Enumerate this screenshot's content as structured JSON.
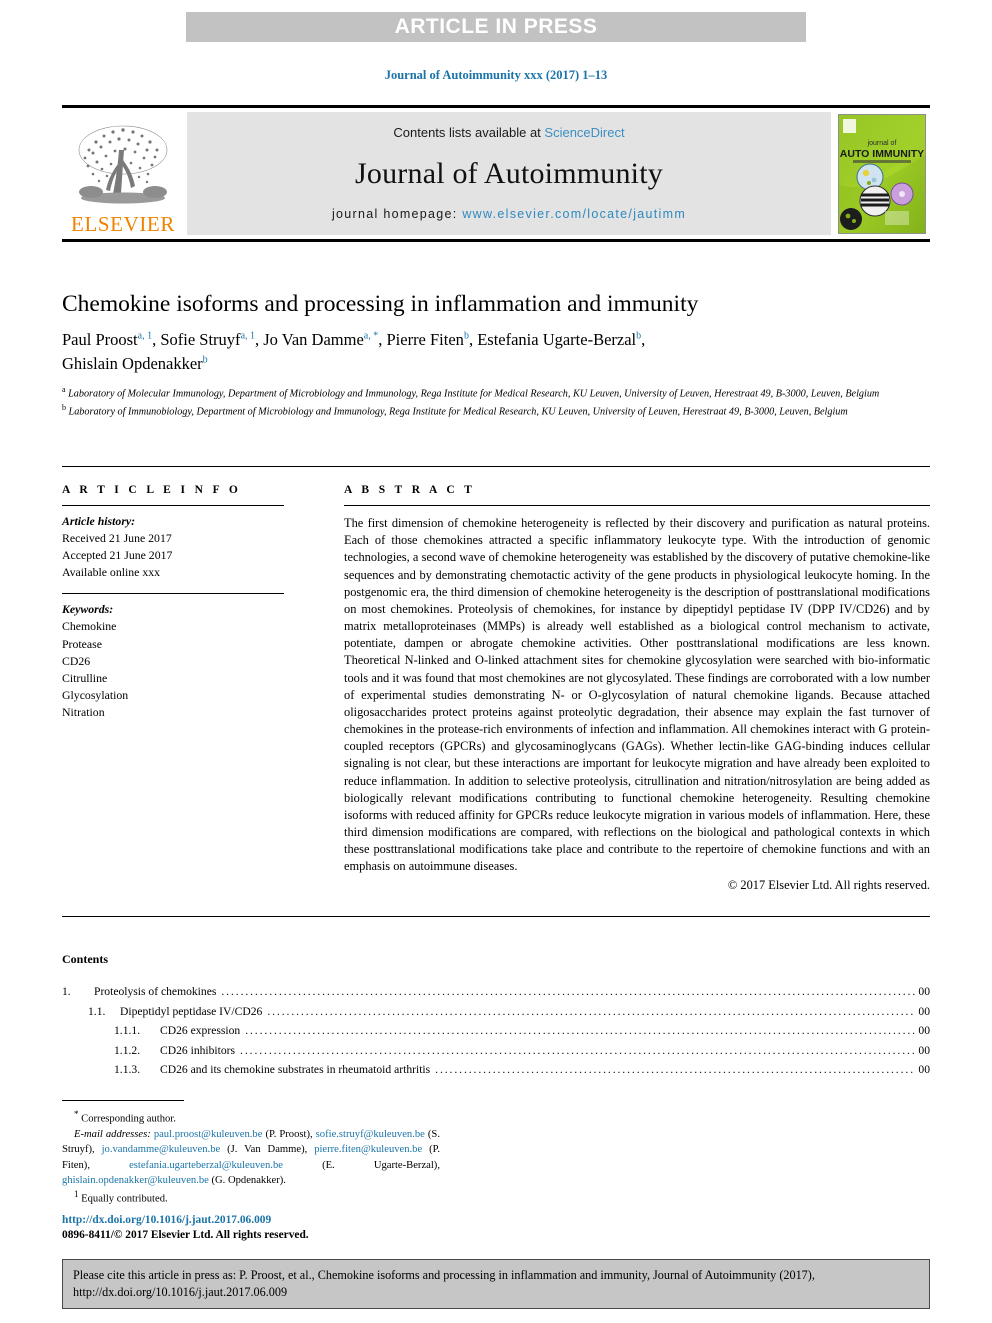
{
  "banner": {
    "text": "ARTICLE IN PRESS"
  },
  "journal_ref": "Journal of Autoimmunity xxx (2017) 1–13",
  "masthead": {
    "contents_prefix": "Contents lists available at ",
    "sciencedirect": "ScienceDirect",
    "journal_name": "Journal of Autoimmunity",
    "homepage_prefix": "journal homepage: ",
    "homepage_url": "www.elsevier.com/locate/jautimm",
    "publisher": "ELSEVIER",
    "cover_title_small": "journal of",
    "cover_title_large": "AUTO IMMUNITY"
  },
  "article": {
    "title": "Chemokine isoforms and processing in inflammation and immunity",
    "authors_line_1": "Paul Proost",
    "authors": [
      {
        "name": "Paul Proost",
        "marks": "a, 1"
      },
      {
        "name": "Sofie Struyf",
        "marks": "a, 1"
      },
      {
        "name": "Jo Van Damme",
        "marks": "a, *"
      },
      {
        "name": "Pierre Fiten",
        "marks": "b"
      },
      {
        "name": "Estefania Ugarte-Berzal",
        "marks": "b"
      },
      {
        "name": "Ghislain Opdenakker",
        "marks": "b"
      }
    ],
    "affiliations": [
      {
        "mark": "a",
        "text": "Laboratory of Molecular Immunology, Department of Microbiology and Immunology, Rega Institute for Medical Research, KU Leuven, University of Leuven, Herestraat 49, B-3000, Leuven, Belgium"
      },
      {
        "mark": "b",
        "text": "Laboratory of Immunobiology, Department of Microbiology and Immunology, Rega Institute for Medical Research, KU Leuven, University of Leuven, Herestraat 49, B-3000, Leuven, Belgium"
      }
    ]
  },
  "article_info": {
    "heading": "A R T I C L E   I N F O",
    "history_label": "Article history:",
    "history": [
      "Received 21 June 2017",
      "Accepted 21 June 2017",
      "Available online xxx"
    ],
    "keywords_label": "Keywords:",
    "keywords": [
      "Chemokine",
      "Protease",
      "CD26",
      "Citrulline",
      "Glycosylation",
      "Nitration"
    ]
  },
  "abstract": {
    "heading": "A B S T R A C T",
    "body": "The first dimension of chemokine heterogeneity is reflected by their discovery and purification as natural proteins. Each of those chemokines attracted a specific inflammatory leukocyte type. With the introduction of genomic technologies, a second wave of chemokine heterogeneity was established by the discovery of putative chemokine-like sequences and by demonstrating chemotactic activity of the gene products in physiological leukocyte homing. In the postgenomic era, the third dimension of chemokine heterogeneity is the description of posttranslational modifications on most chemokines. Proteolysis of chemokines, for instance by dipeptidyl peptidase IV (DPP IV/CD26) and by matrix metalloproteinases (MMPs) is already well established as a biological control mechanism to activate, potentiate, dampen or abrogate chemokine activities. Other posttranslational modifications are less known. Theoretical N-linked and O-linked attachment sites for chemokine glycosylation were searched with bio-informatic tools and it was found that most chemokines are not glycosylated. These findings are corroborated with a low number of experimental studies demonstrating N- or O-glycosylation of natural chemokine ligands. Because attached oligosaccharides protect proteins against proteolytic degradation, their absence may explain the fast turnover of chemokines in the protease-rich environments of infection and inflammation. All chemokines interact with G protein-coupled receptors (GPCRs) and glycosaminoglycans (GAGs). Whether lectin-like GAG-binding induces cellular signaling is not clear, but these interactions are important for leukocyte migration and have already been exploited to reduce inflammation. In addition to selective proteolysis, citrullination and nitration/nitrosylation are being added as biologically relevant modifications contributing to functional chemokine heterogeneity. Resulting chemokine isoforms with reduced affinity for GPCRs reduce leukocyte migration in various models of inflammation. Here, these third dimension modifications are compared, with reflections on the biological and pathological contexts in which these posttranslational modifications take place and contribute to the repertoire of chemokine functions and with an emphasis on autoimmune diseases.",
    "copyright": "© 2017 Elsevier Ltd. All rights reserved."
  },
  "contents": {
    "heading": "Contents",
    "items": [
      {
        "level": 1,
        "number": "1.",
        "label": "Proteolysis of chemokines",
        "page": "00"
      },
      {
        "level": 2,
        "number": "1.1.",
        "label": "Dipeptidyl peptidase IV/CD26",
        "page": "00"
      },
      {
        "level": 3,
        "number": "1.1.1.",
        "label": "CD26 expression",
        "page": "00"
      },
      {
        "level": 3,
        "number": "1.1.2.",
        "label": "CD26 inhibitors",
        "page": "00"
      },
      {
        "level": 3,
        "number": "1.1.3.",
        "label": "CD26 and its chemokine substrates in rheumatoid arthritis",
        "page": "00"
      }
    ]
  },
  "footnotes": {
    "corresponding": "Corresponding author.",
    "email_label": "E-mail addresses:",
    "emails": [
      {
        "address": "paul.proost@kuleuven.be",
        "person": "(P. Proost)"
      },
      {
        "address": "sofie.struyf@kuleuven.be",
        "person": "(S. Struyf)"
      },
      {
        "address": "jo.vandamme@kuleuven.be",
        "person": "(J. Van Damme)"
      },
      {
        "address": "pierre.fiten@kuleuven.be",
        "person": "(P. Fiten)"
      },
      {
        "address": "estefania.ugarteberzal@kuleuven.be",
        "person": "(E. Ugarte-Berzal)"
      },
      {
        "address": "ghislain.opdenakker@kuleuven.be",
        "person": "(G. Opdenakker)"
      }
    ],
    "equal_contribution": "Equally contributed.",
    "doi": "http://dx.doi.org/10.1016/j.jaut.2017.06.009",
    "issn": "0896-8411/© 2017 Elsevier Ltd. All rights reserved."
  },
  "citation_box": {
    "text": "Please cite this article in press as: P. Proost, et al., Chemokine isoforms and processing in inflammation and immunity, Journal of Autoimmunity (2017), http://dx.doi.org/10.1016/j.jaut.2017.06.009"
  },
  "colors": {
    "banner_bg": "#c2c2c2",
    "link_blue": "#1a74a8",
    "elsevier_orange": "#ef8200",
    "masthead_grey": "#e3e3e3",
    "cite_box_grey": "#c6c6c6"
  }
}
